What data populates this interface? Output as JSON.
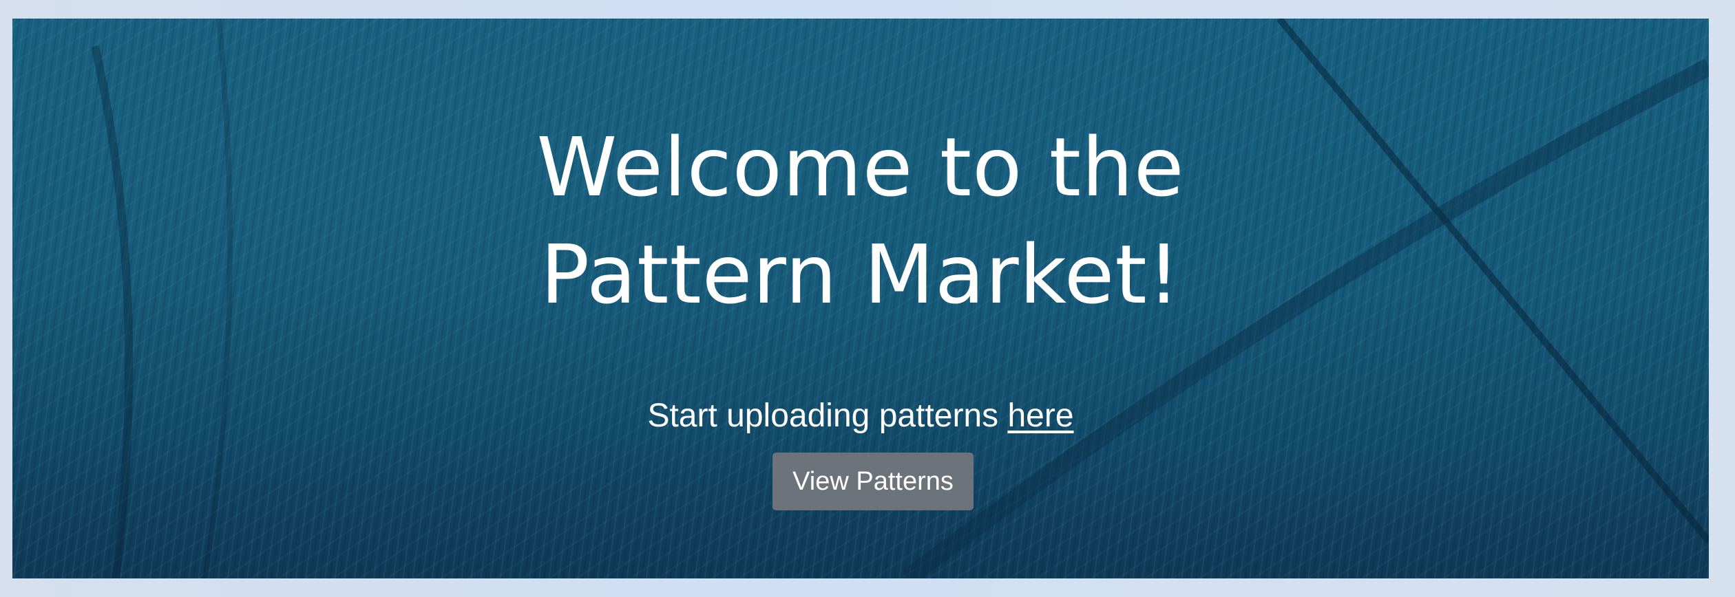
{
  "hero": {
    "title": "Welcome to the Pattern Market!",
    "subtitle_prefix": "Start uploading patterns ",
    "subtitle_link": "here",
    "button_label": "View Patterns"
  },
  "colors": {
    "background": "#d5dfee",
    "hero_blue": "#175f7f",
    "button": "#6c737a",
    "text": "#ffffff"
  }
}
